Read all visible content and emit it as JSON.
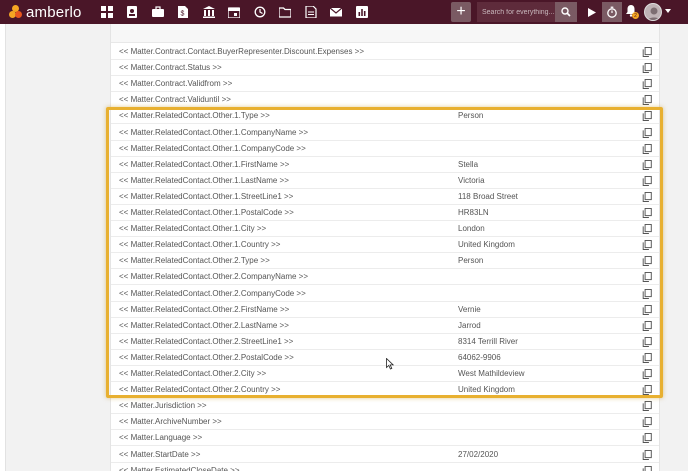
{
  "header": {
    "logo_text": "amberlo",
    "nav_icons": [
      "dashboard-icon",
      "contacts-icon",
      "matters-icon",
      "documents-icon",
      "billing-icon",
      "calendar-icon",
      "history-icon",
      "folder-icon",
      "notes-icon",
      "mail-icon",
      "reports-icon"
    ],
    "add_label": "+",
    "search_placeholder": "Search for everything...",
    "notification_count": "2"
  },
  "rows": [
    {
      "field": "<< Matter.Contract.Contact.BuyerRepresenter.Discount.Expenses >>",
      "value": ""
    },
    {
      "field": "<< Matter.Contract.Status >>",
      "value": ""
    },
    {
      "field": "<< Matter.Contract.Validfrom >>",
      "value": ""
    },
    {
      "field": "<< Matter.Contract.Validuntil >>",
      "value": ""
    },
    {
      "field": "<< Matter.RelatedContact.Other.1.Type >>",
      "value": "Person"
    },
    {
      "field": "<< Matter.RelatedContact.Other.1.CompanyName >>",
      "value": ""
    },
    {
      "field": "<< Matter.RelatedContact.Other.1.CompanyCode >>",
      "value": ""
    },
    {
      "field": "<< Matter.RelatedContact.Other.1.FirstName >>",
      "value": "Stella"
    },
    {
      "field": "<< Matter.RelatedContact.Other.1.LastName >>",
      "value": "Victoria"
    },
    {
      "field": "<< Matter.RelatedContact.Other.1.StreetLine1 >>",
      "value": "118 Broad Street"
    },
    {
      "field": "<< Matter.RelatedContact.Other.1.PostalCode >>",
      "value": "HR83LN"
    },
    {
      "field": "<< Matter.RelatedContact.Other.1.City >>",
      "value": "London"
    },
    {
      "field": "<< Matter.RelatedContact.Other.1.Country >>",
      "value": "United Kingdom"
    },
    {
      "field": "<< Matter.RelatedContact.Other.2.Type >>",
      "value": "Person"
    },
    {
      "field": "<< Matter.RelatedContact.Other.2.CompanyName >>",
      "value": ""
    },
    {
      "field": "<< Matter.RelatedContact.Other.2.CompanyCode >>",
      "value": ""
    },
    {
      "field": "<< Matter.RelatedContact.Other.2.FirstName >>",
      "value": "Vernie"
    },
    {
      "field": "<< Matter.RelatedContact.Other.2.LastName >>",
      "value": "Jarrod"
    },
    {
      "field": "<< Matter.RelatedContact.Other.2.StreetLine1 >>",
      "value": "8314 Terrill River"
    },
    {
      "field": "<< Matter.RelatedContact.Other.2.PostalCode >>",
      "value": "64062-9906"
    },
    {
      "field": "<< Matter.RelatedContact.Other.2.City >>",
      "value": "West Mathildeview"
    },
    {
      "field": "<< Matter.RelatedContact.Other.2.Country >>",
      "value": "United Kingdom"
    },
    {
      "field": "<< Matter.Jurisdiction >>",
      "value": ""
    },
    {
      "field": "<< Matter.ArchiveNumber >>",
      "value": ""
    },
    {
      "field": "<< Matter.Language >>",
      "value": ""
    },
    {
      "field": "<< Matter.StartDate >>",
      "value": "27/02/2020"
    },
    {
      "field": "<< Matter.EstimatedCloseDate >>",
      "value": ""
    }
  ],
  "colors": {
    "header_bg": "#4a1628",
    "highlight_border": "#e8b030",
    "logo_accent": "#f5a623"
  }
}
